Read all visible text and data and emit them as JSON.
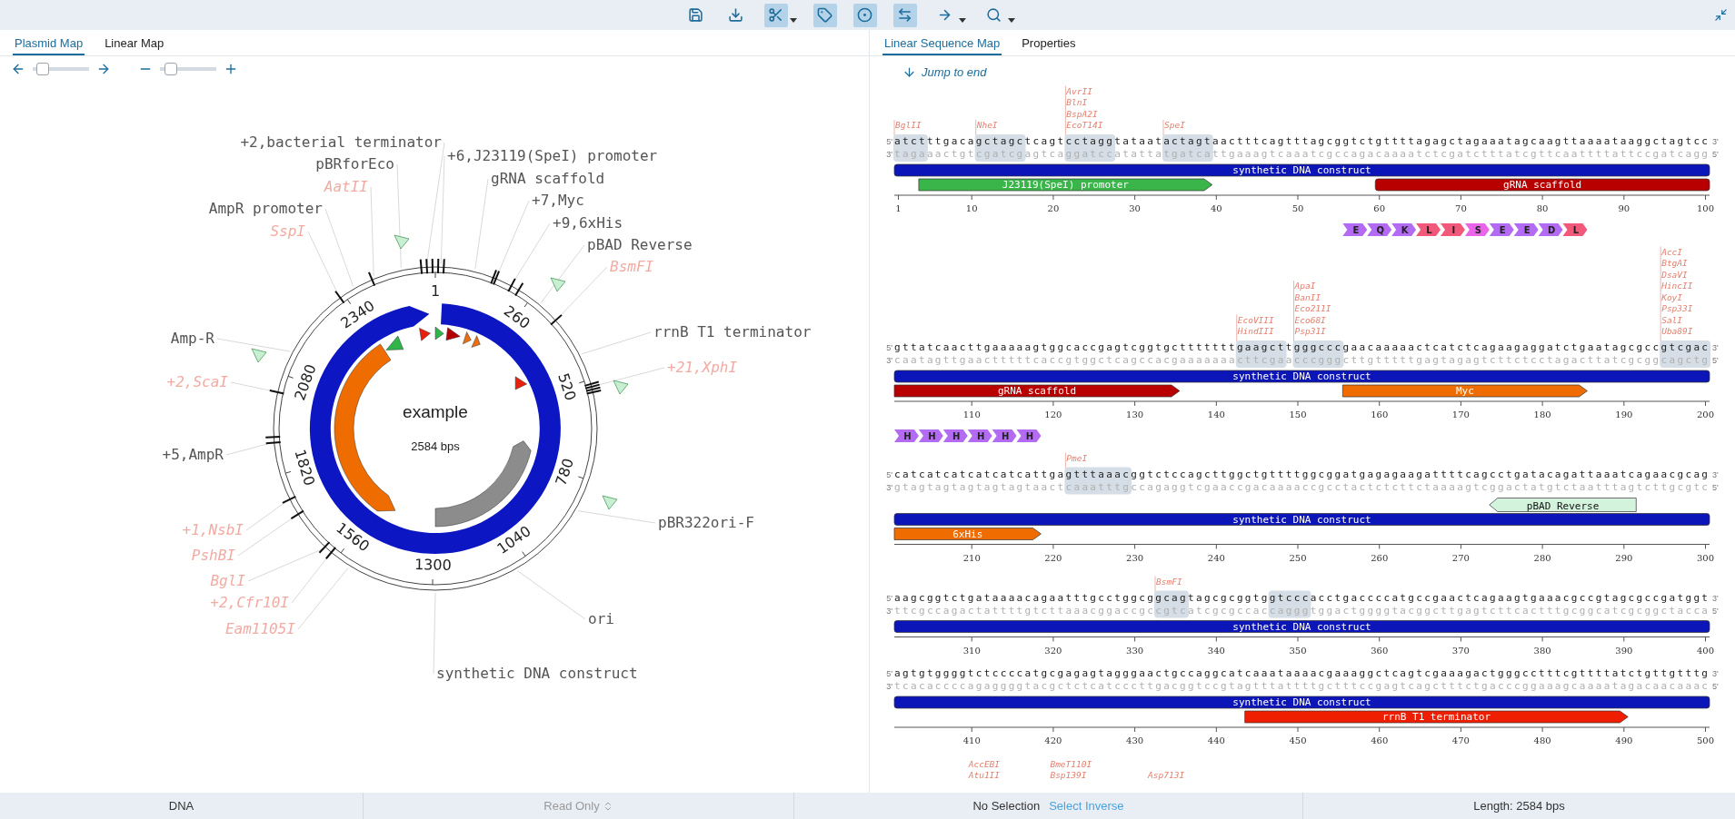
{
  "toolbar": [
    {
      "kind": "save",
      "active": false,
      "dropdown": false
    },
    {
      "kind": "download",
      "active": false,
      "dropdown": false
    },
    {
      "kind": "cut",
      "active": true,
      "dropdown": true
    },
    {
      "kind": "feature",
      "active": true,
      "dropdown": false
    },
    {
      "kind": "orf",
      "active": true,
      "dropdown": false
    },
    {
      "kind": "swap",
      "active": true,
      "dropdown": false
    },
    {
      "kind": "arrow",
      "active": false,
      "dropdown": true
    },
    {
      "kind": "search",
      "active": false,
      "dropdown": true
    }
  ],
  "left_tabs": [
    {
      "label": "Plasmid Map",
      "selected": true
    },
    {
      "label": "Linear Map",
      "selected": false
    }
  ],
  "zoom_controls": [
    {
      "kind": "rotate",
      "level": 0.08
    },
    {
      "kind": "zoom",
      "level": 0.1
    }
  ],
  "plasmid": {
    "name": "example",
    "length": "2584 bps",
    "ticks": [
      "1",
      "260",
      "520",
      "780",
      "1040",
      "1300",
      "1560",
      "1820",
      "2080",
      "2340"
    ],
    "labels": [
      {
        "text": "+2,bacterial terminator",
        "kind": "feature"
      },
      {
        "text": "pBRforEco",
        "kind": "feature"
      },
      {
        "text": "AatII",
        "kind": "enzyme"
      },
      {
        "text": "AmpR promoter",
        "kind": "feature"
      },
      {
        "text": "SspI",
        "kind": "enzyme"
      },
      {
        "text": "+6,J23119(SpeI) promoter",
        "kind": "feature"
      },
      {
        "text": "gRNA scaffold",
        "kind": "feature"
      },
      {
        "text": "+7,Myc",
        "kind": "feature"
      },
      {
        "text": "+9,6xHis",
        "kind": "feature"
      },
      {
        "text": "pBAD Reverse",
        "kind": "feature"
      },
      {
        "text": "BsmFI",
        "kind": "enzyme"
      },
      {
        "text": "rrnB T1 terminator",
        "kind": "feature"
      },
      {
        "text": "+21,XphI",
        "kind": "enzyme"
      },
      {
        "text": "Amp-R",
        "kind": "feature"
      },
      {
        "text": "+2,ScaI",
        "kind": "enzyme"
      },
      {
        "text": "+5,AmpR",
        "kind": "feature"
      },
      {
        "text": "pBR322ori-F",
        "kind": "feature"
      },
      {
        "text": "+1,NsbI",
        "kind": "enzyme"
      },
      {
        "text": "PshBI",
        "kind": "enzyme"
      },
      {
        "text": "BglI",
        "kind": "enzyme"
      },
      {
        "text": "+2,Cfr10I",
        "kind": "enzyme"
      },
      {
        "text": "Eam1105I",
        "kind": "enzyme"
      },
      {
        "text": "ori",
        "kind": "feature"
      },
      {
        "text": "synthetic DNA construct",
        "kind": "feature"
      }
    ]
  },
  "right_tabs": [
    {
      "label": "Linear Sequence Map",
      "selected": true
    },
    {
      "label": "Properties",
      "selected": false
    }
  ],
  "jump_link": "Jump to end",
  "rows": [
    {
      "ends": [
        "5'",
        "3'",
        "3'",
        "5'"
      ],
      "top": "atctttgacagctagctcagtcctaggtataatactagtaactttcagtttagcggtctgttttagagctagaaatagcaagttaaaataaggctagtcc",
      "bottom": "tagaaactgtcgatcgagtcaggatccatattatgatcattgaaagtcaaatcgccagacaaaatctcgatctttatcgttcaattttattccgatcagg",
      "cuts": [
        {
          "names": [
            "BglII"
          ]
        },
        {
          "names": [
            "NheI"
          ]
        },
        {
          "names": [
            "AvrII",
            "BlnI",
            "BspA2I",
            "EcoT14I"
          ]
        },
        {
          "names": [
            "SpeI"
          ]
        }
      ],
      "features": [
        {
          "label": "synthetic DNA construct",
          "color": "#0c16b8",
          "pointed": false
        },
        {
          "label": "J23119(SpeI) promoter",
          "color": "#39b54a",
          "pointed": true
        },
        {
          "label": "gRNA scaffold",
          "color": "#b80000",
          "pointed": false
        }
      ],
      "ticks": [
        "1",
        "10",
        "20",
        "30",
        "40",
        "50",
        "60",
        "70",
        "80",
        "90",
        "100"
      ]
    },
    {
      "ends": [
        "5'",
        "3'",
        "3'",
        "5'"
      ],
      "top": "gttatcaacttgaaaaagtggcaccgagtcggtgctttttttgaagcttgggcccgaacaaaaactcatctcagaagaggatctgaatagcgccgtcgac",
      "bottom": "caatagttgaactttttcaccgtggctcagccacgaaaaaaacttcgaacccgggcttgtttttgagtagagtcttctcctagacttatcgcggcagctg",
      "translation": [
        {
          "aa": "E",
          "color": "#b26bf2"
        },
        {
          "aa": "Q",
          "color": "#b26bf2"
        },
        {
          "aa": "K",
          "color": "#b26bf2"
        },
        {
          "aa": "L",
          "color": "#f2587a"
        },
        {
          "aa": "I",
          "color": "#f2587a"
        },
        {
          "aa": "S",
          "color": "#ea66e8"
        },
        {
          "aa": "E",
          "color": "#b26bf2"
        },
        {
          "aa": "E",
          "color": "#b26bf2"
        },
        {
          "aa": "D",
          "color": "#b26bf2"
        },
        {
          "aa": "L",
          "color": "#f2587a"
        }
      ],
      "cuts": [
        {
          "names": [
            "EcoVIII",
            "HindIII"
          ]
        },
        {
          "names": [
            "ApaI",
            "BanII",
            "Eco211I",
            "Eco68I",
            "Psp31I"
          ]
        },
        {
          "names": [
            "AccI",
            "BtgAI",
            "DsaVI",
            "HincII",
            "KoyI",
            "Psp33I",
            "SalI",
            "Uba89I"
          ]
        }
      ],
      "features": [
        {
          "label": "synthetic DNA construct",
          "color": "#0c16b8",
          "pointed": false
        },
        {
          "label": "gRNA scaffold",
          "color": "#b80000",
          "pointed": true
        },
        {
          "label": "Myc",
          "color": "#ee6c00",
          "pointed": true
        }
      ],
      "ticks": [
        "110",
        "120",
        "130",
        "140",
        "150",
        "160",
        "170",
        "180",
        "190",
        "200"
      ]
    },
    {
      "ends": [
        "5'",
        "3'",
        "3'",
        "5'"
      ],
      "top": "catcatcatcatcatcattgagtttaaacggtctccagcttggctgttttggcggatgagagaagattttcagcctgatacagattaaatcagaacgcag",
      "bottom": "gtagtagtagtagtagtaactcaaatttgccagaggtcgaaccgacaaaaccgcctactctcttctaaaagtcggactatgtctaatttagtcttgcgtc",
      "translation": [
        {
          "aa": "H",
          "color": "#b26bf2"
        },
        {
          "aa": "H",
          "color": "#b26bf2"
        },
        {
          "aa": "H",
          "color": "#b26bf2"
        },
        {
          "aa": "H",
          "color": "#b26bf2"
        },
        {
          "aa": "H",
          "color": "#b26bf2"
        },
        {
          "aa": "H",
          "color": "#b26bf2"
        }
      ],
      "cuts": [
        {
          "names": [
            "PmeI"
          ]
        }
      ],
      "primers": [
        {
          "label": "pBAD Reverse",
          "color": "#d4f3dc",
          "reverse": true
        }
      ],
      "features": [
        {
          "label": "synthetic DNA construct",
          "color": "#0c16b8",
          "pointed": false
        },
        {
          "label": "6xHis",
          "color": "#ee6c00",
          "pointed": true
        }
      ],
      "ticks": [
        "210",
        "220",
        "230",
        "240",
        "250",
        "260",
        "270",
        "280",
        "290",
        "300"
      ]
    },
    {
      "ends": [
        "5'",
        "3'",
        "3'",
        "5'"
      ],
      "top": "aagcggtctgataaaacagaatttgcctggcggcagtagcgcggtggtcccacctgaccccatgccgaactcagaagtgaaacgccgtagcgccgatggt",
      "bottom": "ttcgccagactattttgtcttaaacggaccgccgtcatcgcgccaccagggtggactggggtacggcttgagtcttcactttgcggcatcgcggctacca",
      "cuts": [
        {
          "names": [
            "BsmFI"
          ]
        }
      ],
      "features": [
        {
          "label": "synthetic DNA construct",
          "color": "#0c16b8",
          "pointed": false
        }
      ],
      "ticks": [
        "310",
        "320",
        "330",
        "340",
        "350",
        "360",
        "370",
        "380",
        "390",
        "400"
      ]
    },
    {
      "ends": [
        "5'",
        "3'",
        "3'",
        "5'"
      ],
      "top": "agtgtggggtctccccatgcgagagtagggaactgccaggcatcaaataaaacgaaaggctcagtcgaaagactgggcctttcgttttatctgttgtttg",
      "bottom": "tcacaccccagaggggtacgctctcatcccttgacggtccgtagtttattttgctttccgagtcagctttctgacccggaaagcaaaatagacaacaaac",
      "features": [
        {
          "label": "synthetic DNA construct",
          "color": "#0c16b8",
          "pointed": false
        },
        {
          "label": "rrnB T1 terminator",
          "color": "#f01e00",
          "pointed": true
        }
      ],
      "ticks": [
        "410",
        "420",
        "430",
        "440",
        "450",
        "460",
        "470",
        "480",
        "490",
        "500"
      ]
    },
    {
      "cuts": [
        {
          "names": [
            "AccEBI",
            "Atu1II"
          ]
        },
        {
          "names": [
            "BmeT110I",
            "Bsp139I"
          ]
        },
        {
          "names": [
            "Asp713I"
          ]
        }
      ]
    }
  ],
  "status_bar": {
    "type": "DNA",
    "mode": "Read Only",
    "selection": "No Selection",
    "select_inverse": "Select Inverse",
    "length": "Length: 2584 bps"
  }
}
